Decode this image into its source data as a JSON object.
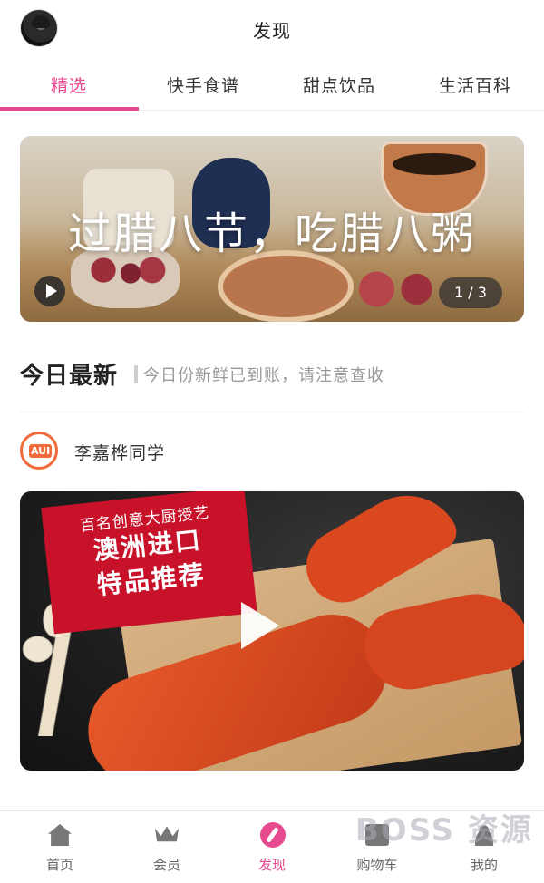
{
  "header": {
    "title": "发现"
  },
  "tabs": [
    {
      "label": "精选",
      "active": true
    },
    {
      "label": "快手食谱",
      "active": false
    },
    {
      "label": "甜点饮品",
      "active": false
    },
    {
      "label": "生活百科",
      "active": false
    }
  ],
  "banner": {
    "headline": "过腊八节，吃腊八粥",
    "pager": "1 / 3"
  },
  "section": {
    "title": "今日最新",
    "subtitle": "今日份新鲜已到账，请注意查收"
  },
  "post": {
    "author": "李嘉桦同学",
    "promo_line1": "百名创意大厨授艺",
    "promo_line2": "澳洲进口",
    "promo_line3": "特品推荐"
  },
  "nav": {
    "items": [
      {
        "label": "首页",
        "icon": "home-icon"
      },
      {
        "label": "会员",
        "icon": "crown-icon"
      },
      {
        "label": "发现",
        "icon": "discover-icon",
        "active": true
      },
      {
        "label": "购物车",
        "icon": "cart-icon"
      },
      {
        "label": "我的",
        "icon": "user-icon"
      }
    ]
  },
  "watermark": "BOSS 资源",
  "colors": {
    "accent": "#e84a8f",
    "promo_red": "#c8122a"
  }
}
